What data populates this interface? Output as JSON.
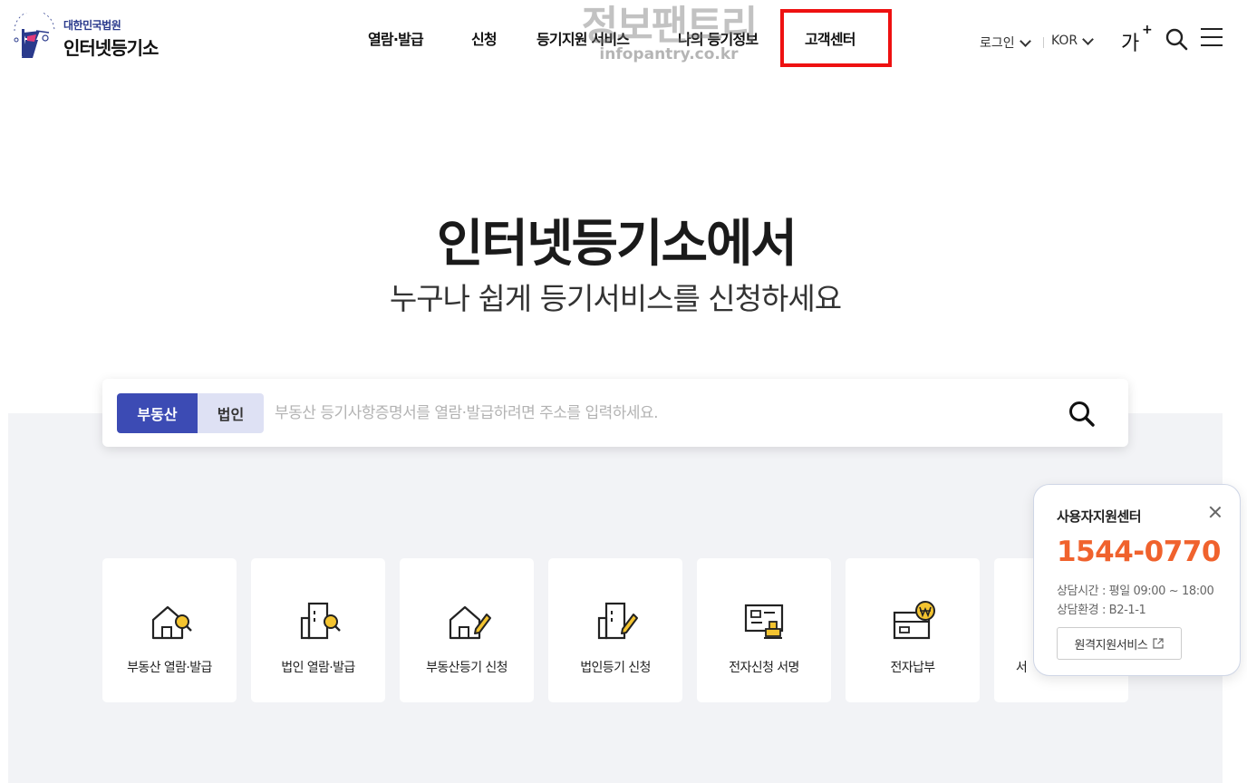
{
  "header": {
    "logo_sub": "대한민국법원",
    "logo_main": "인터넷등기소",
    "nav": [
      {
        "label": "열람·발급"
      },
      {
        "label": "신청"
      },
      {
        "label": "등기지원 서비스"
      },
      {
        "label": "나의 등기정보"
      },
      {
        "label": "고객센터"
      }
    ],
    "login_label": "로그인",
    "lang_label": "KOR",
    "fontsize_label": "가",
    "fontsize_plus": "+",
    "highlight_color": "#ee1111"
  },
  "watermark": {
    "korean": "정보팬트리",
    "url": "infopantry.co.kr"
  },
  "hero": {
    "title": "인터넷등기소에서",
    "subtitle": "누구나 쉽게 등기서비스를 신청하세요"
  },
  "search": {
    "tab_real_estate": "부동산",
    "tab_corporation": "법인",
    "placeholder": "부동산 등기사항증명서를 열람·발급하려면 주소를 입력하세요.",
    "accent_color": "#3c4bb4"
  },
  "services": [
    {
      "label": "부동산 열람·발급",
      "icon": "house-search-icon"
    },
    {
      "label": "법인 열람·발급",
      "icon": "building-search-icon"
    },
    {
      "label": "부동산등기 신청",
      "icon": "house-edit-icon"
    },
    {
      "label": "법인등기 신청",
      "icon": "building-edit-icon"
    },
    {
      "label": "전자신청 서명",
      "icon": "certificate-stamp-icon"
    },
    {
      "label": "전자납부",
      "icon": "wallet-won-icon"
    },
    {
      "label": "서",
      "icon": "partial-service-icon"
    }
  ],
  "support": {
    "title": "사용자지원센터",
    "phone": "1544-0770",
    "hours": "상담시간 : 평일 09:00 ~ 18:00",
    "location": "상담환경 : B2-1-1",
    "remote_button": "원격지원서비스",
    "phone_color": "#f0622d"
  }
}
